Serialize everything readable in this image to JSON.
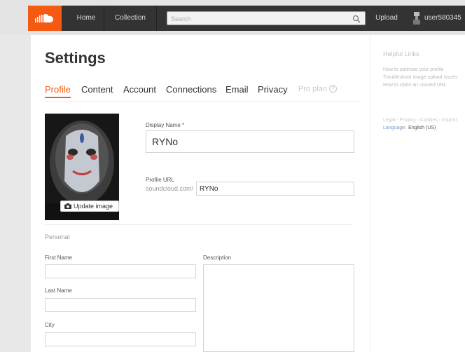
{
  "nav": {
    "home": "Home",
    "collection": "Collection",
    "search_placeholder": "Search",
    "upload": "Upload",
    "username": "user580345"
  },
  "settings": {
    "title": "Settings",
    "tabs": [
      {
        "label": "Profile"
      },
      {
        "label": "Content"
      },
      {
        "label": "Account"
      },
      {
        "label": "Connections"
      },
      {
        "label": "Email"
      },
      {
        "label": "Privacy"
      },
      {
        "label": "Pro plan"
      }
    ],
    "update_image": "Update image",
    "display_name_label": "Display Name *",
    "display_name_value": "RYNo",
    "profile_url_label": "Profile URL",
    "profile_url_prefix": "soundcloud.com/",
    "profile_url_value": "RYNo",
    "personal_heading": "Personal",
    "first_name_label": "First Name",
    "last_name_label": "Last Name",
    "city_label": "City",
    "description_label": "Description"
  },
  "sidebar": {
    "heading": "Helpful Links",
    "links": [
      "How to optimize your profile",
      "Troubleshoot image upload issues",
      "How to claim an unused URL"
    ],
    "footer": [
      "Legal",
      "Privacy",
      "Cookies",
      "Imprint"
    ],
    "language_key": "Language:",
    "language_value": "English (US)"
  },
  "colors": {
    "accent": "#f55a12",
    "nav_background": "#333333"
  }
}
